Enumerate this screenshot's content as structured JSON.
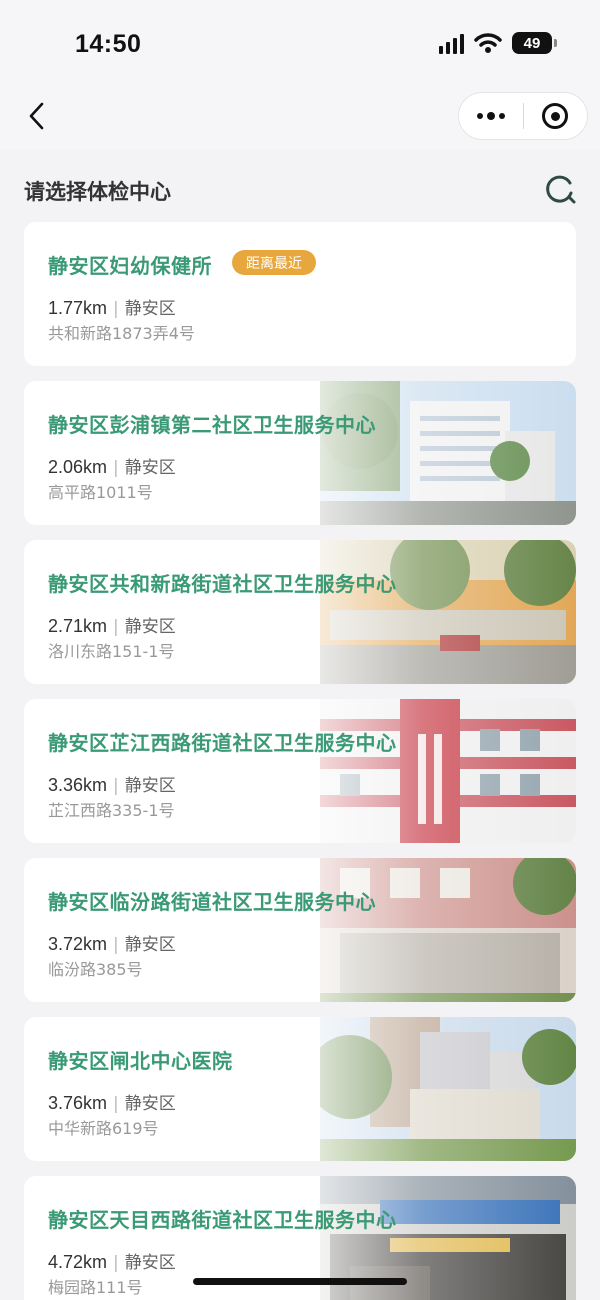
{
  "status_bar": {
    "time": "14:50",
    "battery": "49"
  },
  "header": {
    "title": "请选择体检中心"
  },
  "centers": [
    {
      "name": "静安区妇幼保健所",
      "badge": "距离最近",
      "distance": "1.77km",
      "district": "静安区",
      "address": "共和新路1873弄4号",
      "photo": null
    },
    {
      "name": "静安区彭浦镇第二社区卫生服务中心",
      "distance": "2.06km",
      "district": "静安区",
      "address": "高平路1011号",
      "photo": "building"
    },
    {
      "name": "静安区共和新路街道社区卫生服务中心",
      "distance": "2.71km",
      "district": "静安区",
      "address": "洛川东路151-1号",
      "photo": "street"
    },
    {
      "name": "静安区芷江西路街道社区卫生服务中心",
      "distance": "3.36km",
      "district": "静安区",
      "address": "芷江西路335-1号",
      "photo": "redsign"
    },
    {
      "name": "静安区临汾路街道社区卫生服务中心",
      "distance": "3.72km",
      "district": "静安区",
      "address": "临汾路385号",
      "photo": "stone"
    },
    {
      "name": "静安区闸北中心医院",
      "distance": "3.76km",
      "district": "静安区",
      "address": "中华新路619号",
      "photo": "hospital"
    },
    {
      "name": "静安区天目西路街道社区卫生服务中心",
      "distance": "4.72km",
      "district": "静安区",
      "address": "梅园路111号",
      "photo": "entrance"
    }
  ],
  "colors": {
    "accent_green": "#3a9a76",
    "badge_orange": "#e8a73c",
    "background": "#f3f3f5"
  }
}
